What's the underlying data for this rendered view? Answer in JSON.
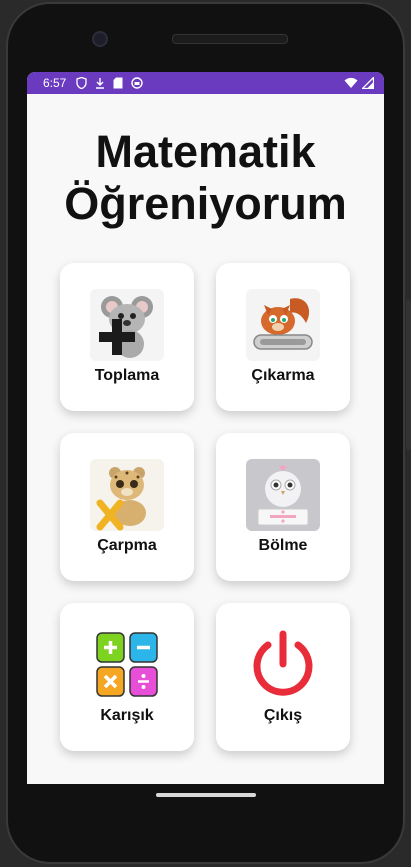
{
  "status": {
    "time": "6:57",
    "icons": [
      "shield-icon",
      "download-icon",
      "sd-card-icon",
      "app-icon"
    ],
    "right_icons": [
      "wifi-icon",
      "signal-icon"
    ]
  },
  "title_line1": "Matematik",
  "title_line2": "Öğreniyorum",
  "cards": [
    {
      "label": "Toplama",
      "icon": "koala-plus-image"
    },
    {
      "label": "Çıkarma",
      "icon": "squirrel-minus-image"
    },
    {
      "label": "Çarpma",
      "icon": "cheetah-times-image"
    },
    {
      "label": "Bölme",
      "icon": "owl-divide-image"
    },
    {
      "label": "Karışık",
      "icon": "mixed-operations-icon"
    },
    {
      "label": "Çıkış",
      "icon": "power-icon"
    }
  ],
  "colors": {
    "status_bar": "#6a3bbf",
    "plus_tile": "#7ed321",
    "minus_tile": "#2cb5e8",
    "times_tile": "#f5a623",
    "divide_tile": "#e84fd8",
    "power": "#e82c3a"
  }
}
